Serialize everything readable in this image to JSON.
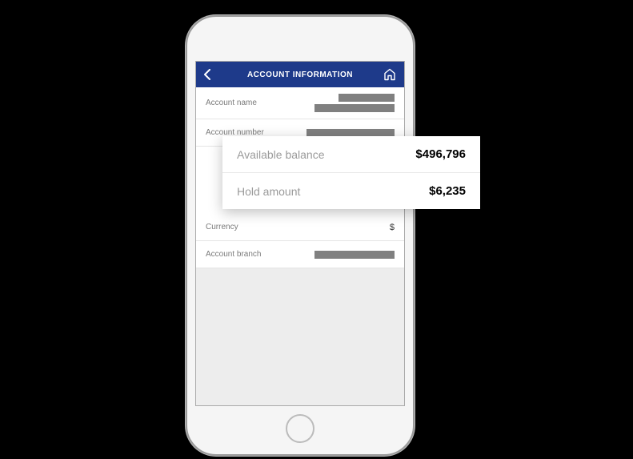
{
  "header": {
    "title": "ACCOUNT INFORMATION"
  },
  "rows": {
    "account_name": {
      "label": "Account name"
    },
    "account_number": {
      "label": "Account number"
    },
    "currency": {
      "label": "Currency",
      "value": "$"
    },
    "account_branch": {
      "label": "Account branch"
    }
  },
  "callout": {
    "available_balance": {
      "label": "Available balance",
      "value": "$496,796"
    },
    "hold_amount": {
      "label": "Hold amount",
      "value": "$6,235"
    }
  },
  "colors": {
    "header_bg": "#1e3a8a"
  }
}
